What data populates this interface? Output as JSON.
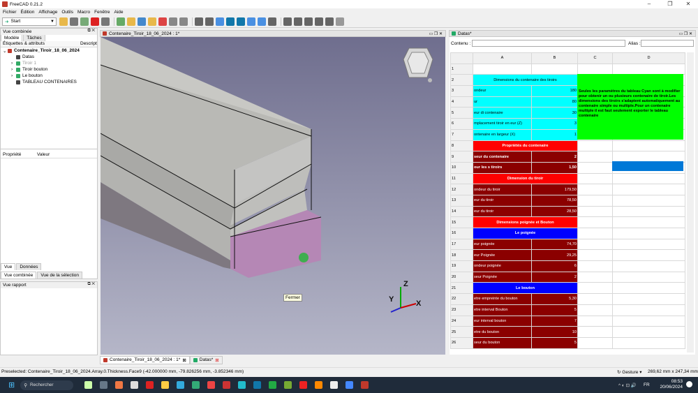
{
  "app": {
    "title": "FreeCAD 0.21.2"
  },
  "menu": [
    "Fichier",
    "Édition",
    "Affichage",
    "Outils",
    "Macro",
    "Fenêtre",
    "Aide"
  ],
  "workbench": "Start",
  "combo": {
    "title": "Vue combinée",
    "tabs": [
      "Modèle",
      "Tâches"
    ],
    "labels_header": "Étiquettes & attributs",
    "desc_header": "Descript",
    "tree": [
      {
        "label": "Contenaire_Tiroir_18_06_2024",
        "bold": true,
        "level": 0,
        "icon": "document-icon"
      },
      {
        "label": "Datas",
        "level": 1,
        "icon": "spreadsheet-icon"
      },
      {
        "label": "Tiroir 1",
        "level": 1,
        "icon": "part-icon",
        "muted": true
      },
      {
        "label": "Tiroir bouton",
        "level": 1,
        "icon": "part-icon"
      },
      {
        "label": "Le bouton",
        "level": 1,
        "icon": "part-icon"
      },
      {
        "label": "TABLEAU CONTENAIRES",
        "level": 1,
        "icon": "spreadsheet-icon"
      }
    ],
    "prop_headers": [
      "Propriété",
      "Valeur"
    ],
    "bottom_tabs": [
      "Vue",
      "Données"
    ],
    "bottom_tabs2": [
      "Vue combinée",
      "Vue de la sélection"
    ]
  },
  "report": {
    "title": "Vue rapport"
  },
  "viewport": {
    "title": "Contenaire_Tiroir_18_06_2024 : 1*",
    "tooltip": "Fermer",
    "axes": {
      "x": "X",
      "y": "Y",
      "z": "Z"
    }
  },
  "sheet": {
    "title": "Datas*",
    "contenu_label": "Contenu :",
    "alias_label": "Alias :",
    "col_headers": [
      "",
      "A",
      "B",
      "C",
      "D"
    ],
    "rows": [
      {
        "n": "1",
        "a": "",
        "b": "",
        "s": ""
      },
      {
        "n": "2",
        "a": "Dimensions du contenaire des tiroirs",
        "b": "",
        "s": "cyanhead"
      },
      {
        "n": "3",
        "a": "ondeur",
        "b": "180",
        "s": "cyan"
      },
      {
        "n": "4",
        "a": "ur",
        "b": "80",
        "s": "cyan"
      },
      {
        "n": "5",
        "a": "eur di contenaire",
        "b": "30",
        "s": "cyan"
      },
      {
        "n": "6",
        "a": "mplacement tiroir en eur (Z)",
        "b": "3",
        "s": "cyan"
      },
      {
        "n": "7",
        "a": "ontenaire en largeur (X)",
        "b": "1",
        "s": "cyan"
      },
      {
        "n": "8",
        "a": "Propriétés du contenaire",
        "b": "",
        "s": "red"
      },
      {
        "n": "9",
        "a": "seur du contenaire",
        "b": "2",
        "s": "dred"
      },
      {
        "n": "10",
        "a": "our les s tiroirs",
        "b": "1,50",
        "s": "dred"
      },
      {
        "n": "11",
        "a": "Dimension du tiroir",
        "b": "",
        "s": "red"
      },
      {
        "n": "12",
        "a": "ondeur du tiroir",
        "b": "179,50",
        "s": "dred"
      },
      {
        "n": "13",
        "a": "eur du tiroir",
        "b": "78,50",
        "s": "dred"
      },
      {
        "n": "14",
        "a": "eur du tiroir",
        "b": "28,50",
        "s": "dred"
      },
      {
        "n": "15",
        "a": "Dimensions poignée et Bouton",
        "b": "",
        "s": "red"
      },
      {
        "n": "16",
        "a": "Le poignée",
        "b": "",
        "s": "blue"
      },
      {
        "n": "17",
        "a": "eur poignée",
        "b": "74,70",
        "s": "dred"
      },
      {
        "n": "18",
        "a": "eur Poignée",
        "b": "29,25",
        "s": "dred"
      },
      {
        "n": "19",
        "a": "ondeur poignée",
        "b": "6",
        "s": "dred"
      },
      {
        "n": "20",
        "a": "seur Poignée",
        "b": "2",
        "s": "dred"
      },
      {
        "n": "21",
        "a": "Le bouton",
        "b": "",
        "s": "blue"
      },
      {
        "n": "22",
        "a": "etre empreinte du bouton",
        "b": "5,30",
        "s": "dred"
      },
      {
        "n": "23",
        "a": "etre interval Bouton",
        "b": "5",
        "s": "dred"
      },
      {
        "n": "24",
        "a": "eur interval bouton",
        "b": "7",
        "s": "dred"
      },
      {
        "n": "25",
        "a": "etre du bouton",
        "b": "10",
        "s": "dred"
      },
      {
        "n": "26",
        "a": "seur du bouton",
        "b": "5",
        "s": "dred"
      }
    ],
    "note": "Seules les paramètres du tableau Cyan sont à modifier pour obtenir un ou plusieurs contenaire de tiroir.Les dimensions des tiroirs s'adaptent automatiquement au contenaire simple ou multiple.Pour un contenaire multiple il est faut seulement exporter le tableau contenaire"
  },
  "doc_tabs": [
    "Contenaire_Tiroir_18_06_2024 : 1*",
    "Datas*"
  ],
  "status": {
    "text": "Preselected: Contenaire_Tiroir_18_06_2024.Array.0.Thickness.Face9 (-42.000000 mm, -79.826256 mm, -3.852346 mm)",
    "nav": "Gesture",
    "dims": "269,62 mm x 247,34 mm"
  },
  "taskbar": {
    "search": "Rechercher",
    "lang": "FR",
    "time": "08:53",
    "date": "20/06/2024"
  },
  "colors": {
    "cyan": "#00ffff",
    "green": "#00ff00",
    "red": "#ff0000",
    "dark_red": "#8b0000",
    "blue": "#0000ff"
  }
}
